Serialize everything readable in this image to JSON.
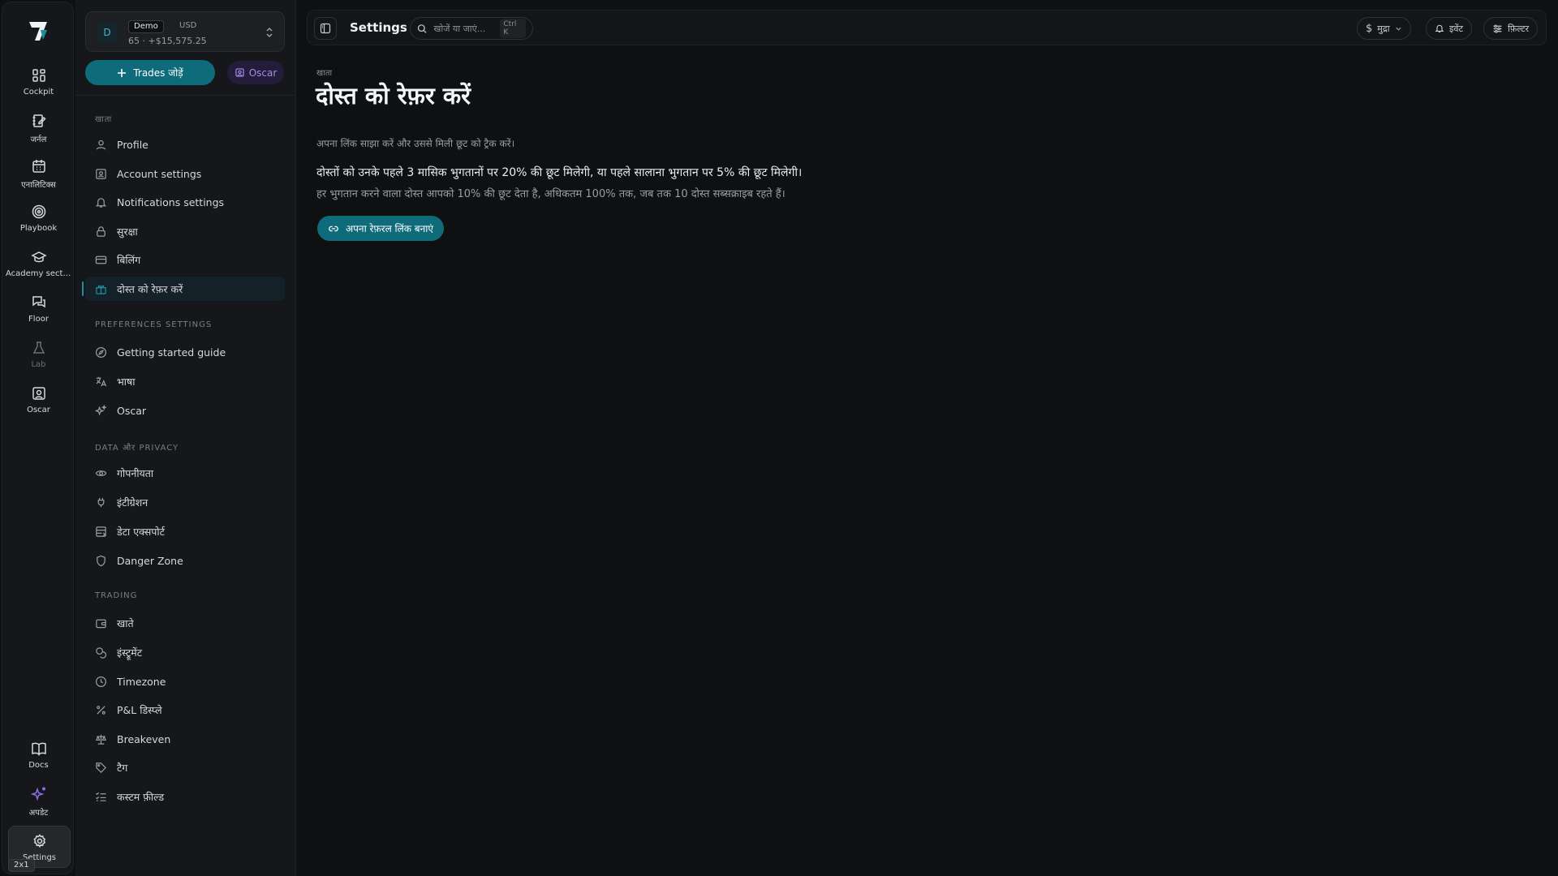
{
  "rail": {
    "items": [
      {
        "label": "Cockpit",
        "icon": "grid-icon"
      },
      {
        "label": "जर्नल",
        "icon": "journal-edit-icon"
      },
      {
        "label": "एनालिटिक्स",
        "icon": "calendar-icon"
      },
      {
        "label": "Playbook",
        "icon": "target-icon"
      },
      {
        "label": "Academy secti...",
        "icon": "graduation-cap-icon"
      },
      {
        "label": "Floor",
        "icon": "chat-bubbles-icon"
      },
      {
        "label": "Lab",
        "icon": "flask-icon"
      },
      {
        "label": "Oscar",
        "icon": "oscar-portrait-icon"
      },
      {
        "label": "Docs",
        "icon": "book-icon"
      },
      {
        "label": "अपडेट",
        "icon": "sparkles-icon"
      },
      {
        "label": "Settings",
        "icon": "gear-icon"
      }
    ],
    "zoom_badge": "2x1"
  },
  "account": {
    "avatar": "D",
    "mode": "Demo",
    "currency": "USD",
    "balance": "65 · +$15,575.25"
  },
  "actions": {
    "add_trades": "Trades जोड़ें",
    "oscar": "Oscar"
  },
  "sidebar": {
    "sections": [
      {
        "label": "खाता",
        "items": [
          {
            "label": "Profile",
            "icon": "user-icon"
          },
          {
            "label": "Account settings",
            "icon": "account-card-icon"
          },
          {
            "label": "Notifications settings",
            "icon": "bell-icon"
          },
          {
            "label": "सुरक्षा",
            "icon": "lock-icon"
          },
          {
            "label": "बिलिंग",
            "icon": "credit-card-icon"
          },
          {
            "label": "दोस्त को रेफ़र करें",
            "icon": "gift-icon",
            "active": true
          }
        ]
      },
      {
        "label": "Preferences settings",
        "items": [
          {
            "label": "Getting started guide",
            "icon": "compass-icon"
          },
          {
            "label": "भाषा",
            "icon": "translate-icon"
          },
          {
            "label": "Oscar",
            "icon": "sparkles-icon"
          }
        ]
      },
      {
        "label": "Data और privacy",
        "items": [
          {
            "label": "गोपनीयता",
            "icon": "eye-icon"
          },
          {
            "label": "इंटीग्रेशन",
            "icon": "plug-icon"
          },
          {
            "label": "डेटा एक्सपोर्ट",
            "icon": "database-export-icon"
          },
          {
            "label": "Danger Zone",
            "icon": "shield-icon"
          }
        ]
      },
      {
        "label": "Trading",
        "items": [
          {
            "label": "खाते",
            "icon": "wallet-icon"
          },
          {
            "label": "इंस्ट्रूमेंट",
            "icon": "coins-icon"
          },
          {
            "label": "Timezone",
            "icon": "clock-icon"
          },
          {
            "label": "P&L डिस्प्ले",
            "icon": "percent-icon"
          },
          {
            "label": "Breakeven",
            "icon": "scale-icon"
          },
          {
            "label": "टैग",
            "icon": "tag-icon"
          },
          {
            "label": "कस्टम फ़ील्ड",
            "icon": "list-checks-icon"
          }
        ]
      }
    ]
  },
  "topbar": {
    "title": "Settings",
    "search_placeholder": "खोजें या जाएं...",
    "search_shortcut": "Ctrl K",
    "currency_label": "मुद्रा",
    "events_label": "इवेंट",
    "filter_label": "फ़िल्टर"
  },
  "main": {
    "breadcrumb": "खाता",
    "title": "दोस्त को रेफ़र करें",
    "subtitle": "अपना लिंक साझा करें और उससे मिली छूट को ट्रैक करें।",
    "line1": "दोस्तों को उनके पहले 3 मासिक भुगतानों पर 20% की छूट मिलेगी, या पहले सालाना भुगतान पर 5% की छूट मिलेगी।",
    "line2": "हर भुगतान करने वाला दोस्त आपको 10% की छूट देता है, अधिकतम 100% तक, जब तक 10 दोस्त सब्सक्राइब रहते हैं।",
    "cta": "अपना रेफ़रल लिंक बनाएं"
  },
  "colors": {
    "accent": "#0d6b7a",
    "oscar_purple": "#a98be8",
    "background": "#0f1012"
  }
}
